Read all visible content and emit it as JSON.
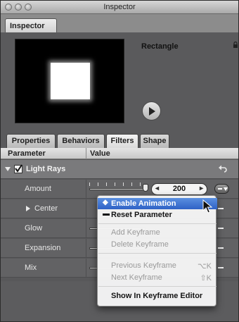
{
  "window": {
    "title": "Inspector"
  },
  "top_tab": {
    "label": "Inspector"
  },
  "object": {
    "name": "Rectangle"
  },
  "tabs": [
    {
      "label": "Properties",
      "active": false
    },
    {
      "label": "Behaviors",
      "active": false
    },
    {
      "label": "Filters",
      "active": true
    },
    {
      "label": "Shape",
      "active": false
    }
  ],
  "columns": {
    "parameter": "Parameter",
    "value": "Value"
  },
  "rows": {
    "group": {
      "label": "Light Rays",
      "checked": true
    },
    "amount": {
      "label": "Amount",
      "value": "200",
      "left_arrow": "◂",
      "right_arrow": "▸"
    },
    "center": {
      "label": "Center"
    },
    "glow": {
      "label": "Glow"
    },
    "expansion": {
      "label": "Expansion"
    },
    "mix": {
      "label": "Mix"
    }
  },
  "context_menu": {
    "items": [
      {
        "label": "Enable Animation",
        "mark": "◆",
        "highlighted": true
      },
      {
        "label": "Reset Parameter",
        "mark": "▬"
      },
      {
        "label": "Add Keyframe",
        "disabled": true
      },
      {
        "label": "Delete Keyframe",
        "disabled": true
      },
      {
        "label": "Previous Keyframe",
        "shortcut": "⌥K",
        "disabled": true
      },
      {
        "label": "Next Keyframe",
        "shortcut": "⇧K",
        "disabled": true
      },
      {
        "label": "Show In Keyframe Editor"
      }
    ]
  },
  "colors": {
    "highlight": "#3a6fd2",
    "panel": "#5a5a5c"
  }
}
